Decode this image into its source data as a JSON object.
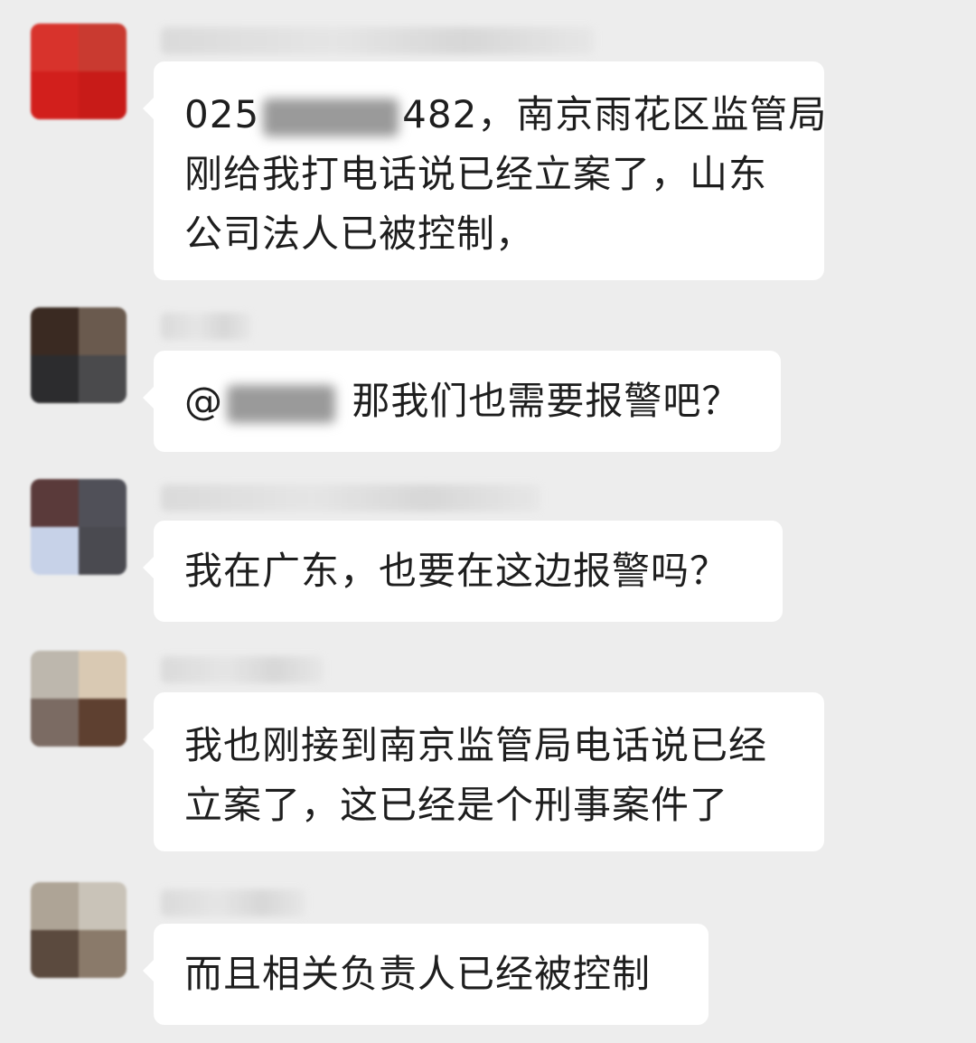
{
  "messages": [
    {
      "avatar_colors": [
        "#d8332c",
        "#c93a30",
        "#d21f1c",
        "#c81b18"
      ],
      "lines": [
        {
          "before": "025",
          "after": "482，南京雨花区监管局"
        },
        {
          "text": "刚给我打电话说已经立案了，山东"
        },
        {
          "text": "公司法人已被控制，"
        }
      ]
    },
    {
      "avatar_colors": [
        "#3a2a22",
        "#6a5a4e",
        "#2c2c2e",
        "#4a4a4c"
      ],
      "lines": [
        {
          "before": "@",
          "after": " 那我们也需要报警吧？"
        }
      ]
    },
    {
      "avatar_colors": [
        "#5a3a3a",
        "#505058",
        "#c7d2e8",
        "#4a4a50"
      ],
      "lines": [
        {
          "text": "我在广东，也要在这边报警吗？"
        }
      ]
    },
    {
      "avatar_colors": [
        "#bdb7ad",
        "#d9c9b3",
        "#7b6b63",
        "#5e4030"
      ],
      "lines": [
        {
          "text": "我也刚接到南京监管局电话说已经"
        },
        {
          "text": "立案了，这已经是个刑事案件了"
        }
      ]
    },
    {
      "avatar_colors": [
        "#aea496",
        "#c9c3b8",
        "#5b4a3e",
        "#8a7a6a"
      ],
      "lines": [
        {
          "text": "而且相关负责人已经被控制"
        }
      ]
    }
  ]
}
